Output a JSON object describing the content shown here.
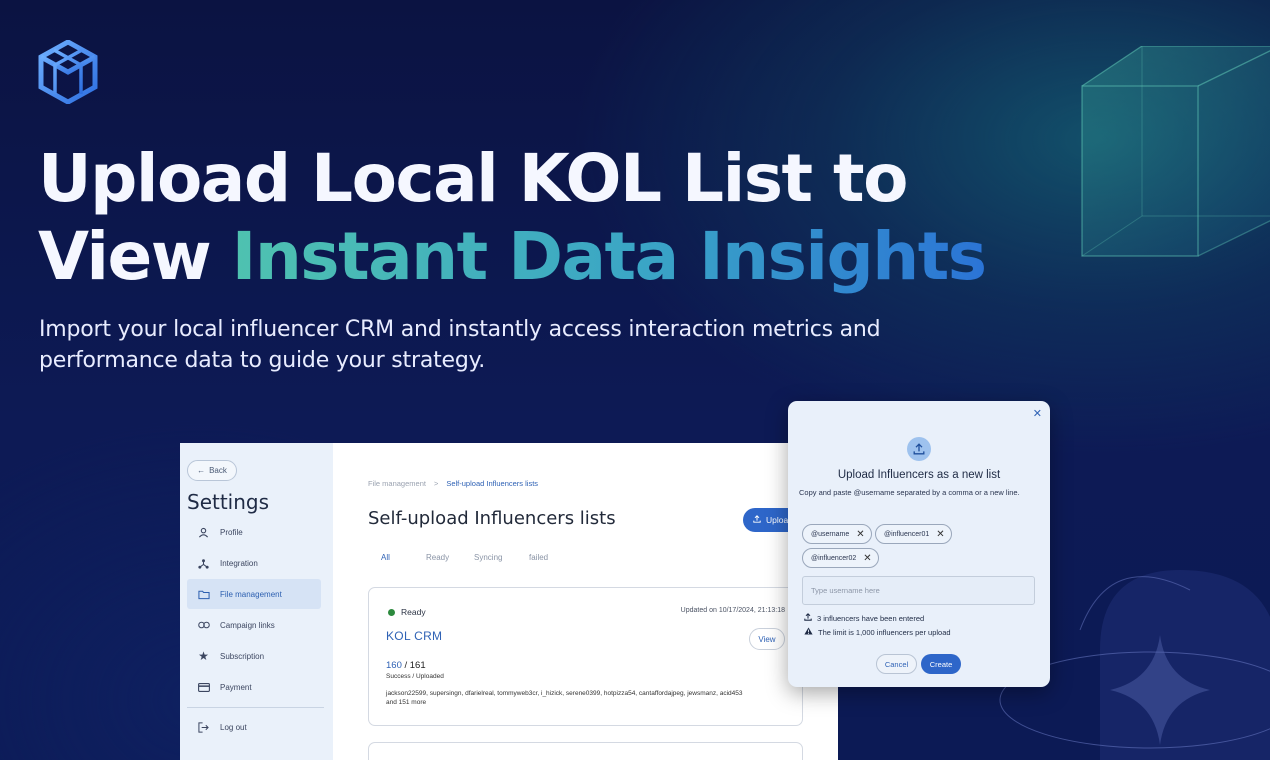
{
  "hero": {
    "title_line1": "Upload Local KOL List to",
    "title_line2_plain": "View",
    "title_line2_accent": "Instant Data Insights",
    "subtitle": "Import your local influencer CRM and instantly access interaction metrics and performance data to guide your strategy."
  },
  "sidebar": {
    "back_label": "Back",
    "title": "Settings",
    "items": [
      {
        "label": "Profile",
        "icon": "person-icon"
      },
      {
        "label": "Integration",
        "icon": "integration-icon"
      },
      {
        "label": "File management",
        "icon": "folder-icon"
      },
      {
        "label": "Campaign links",
        "icon": "link-icon"
      },
      {
        "label": "Subscription",
        "icon": "star-icon"
      },
      {
        "label": "Payment",
        "icon": "card-icon"
      }
    ],
    "logout_label": "Log out"
  },
  "main": {
    "breadcrumb": [
      "File management",
      "Self-upload Influencers lists"
    ],
    "title": "Self-upload Influencers lists",
    "upload_label": "Upload",
    "tabs": [
      "All",
      "Ready",
      "Syncing",
      "failed"
    ],
    "card": {
      "status": "Ready",
      "updated": "Updated on 10/17/2024, 21:13:18",
      "name": "KOL CRM",
      "view_label": "View",
      "success_count": "160",
      "total": "/ 161",
      "count_label": "Success / Uploaded",
      "names": "jackson22599, supersingn, dfarielreal, tommyweb3cr, i_hizick, serene0399, hotpizza54, cantaffordajpeg, jewsmanz, acid453",
      "more": "and 151 more"
    }
  },
  "modal": {
    "close": "✕",
    "title": "Upload Influencers as a new list",
    "description": "Copy and paste @username separated by a comma or a new line.",
    "chips": [
      "@username",
      "@influencer01",
      "@influencer02"
    ],
    "input_placeholder": "Type username here",
    "entered": "3 influencers have been entered",
    "limit": "The limit is 1,000 influencers per upload",
    "cancel_label": "Cancel",
    "create_label": "Create"
  }
}
